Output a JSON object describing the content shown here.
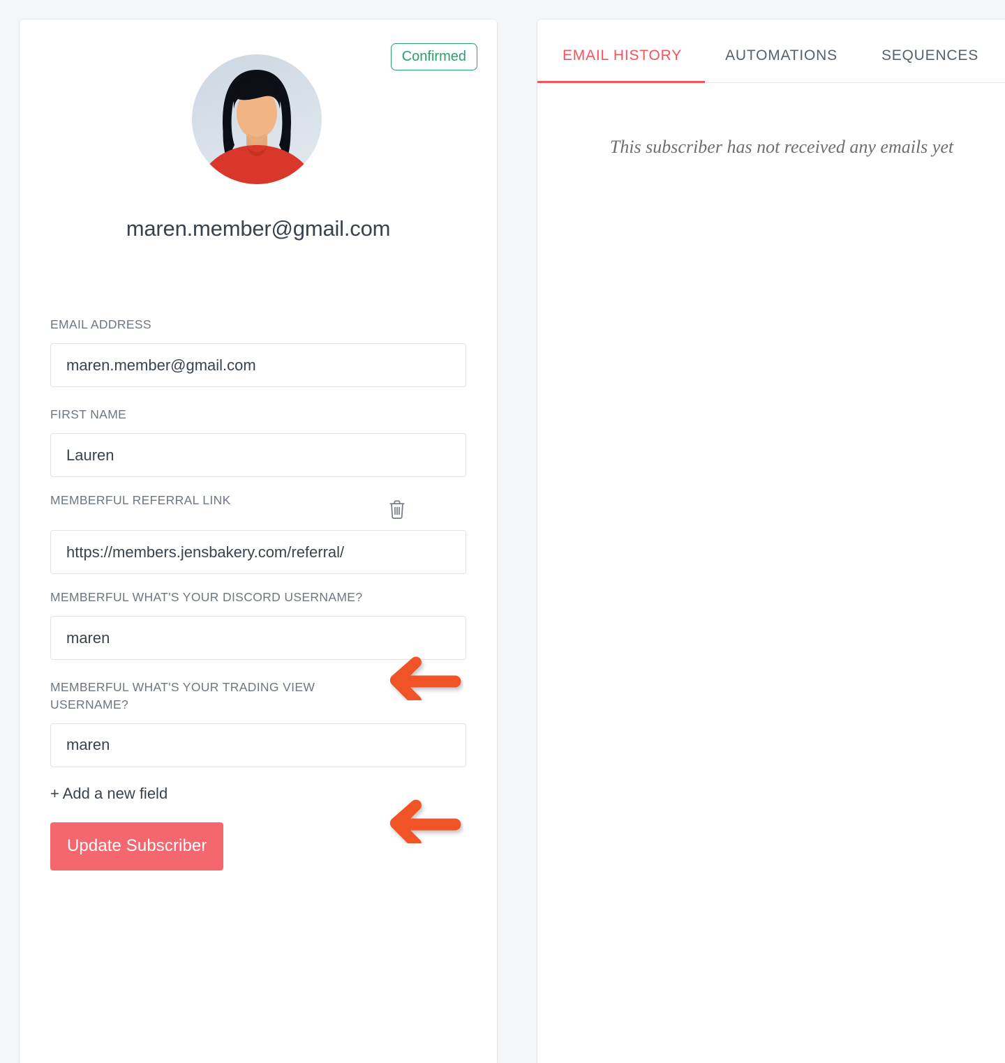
{
  "theme": {
    "page_background": "#f4f6f8",
    "card_background": "#ffffff",
    "accent_red": "#f4535c",
    "button_color": "#f4676e",
    "badge_green": "#2aa06c",
    "label_gray": "#6d7782",
    "annotation_orange": "#ef5226"
  },
  "subscriber": {
    "status_badge": "Confirmed",
    "email_heading": "maren.member@gmail.com",
    "avatar_alt": "subscriber-avatar"
  },
  "form": {
    "fields": [
      {
        "label": "EMAIL ADDRESS",
        "value": "maren.member@gmail.com",
        "placeholder": "",
        "name": "email-address",
        "deletable": false
      },
      {
        "label": "FIRST NAME",
        "value": "Lauren",
        "placeholder": "",
        "name": "first-name",
        "deletable": false
      },
      {
        "label": "MEMBERFUL REFERRAL LINK",
        "value": "https://members.jensbakery.com/referral/",
        "placeholder": "",
        "name": "memberful-referral-link",
        "deletable": true
      },
      {
        "label": "MEMBERFUL WHAT'S YOUR DISCORD USERNAME?",
        "value": "maren",
        "placeholder": "",
        "name": "memberful-discord-username",
        "deletable": false
      },
      {
        "label": "MEMBERFUL WHAT'S YOUR TRADING VIEW USERNAME?",
        "value": "maren",
        "placeholder": "",
        "name": "memberful-tradingview-username",
        "deletable": false
      }
    ],
    "add_field_label": "+ Add a new field",
    "submit_label": "Update Subscriber",
    "delete_icon": "trash-icon"
  },
  "detail_panel": {
    "tabs": [
      {
        "label": "EMAIL HISTORY",
        "active": true
      },
      {
        "label": "AUTOMATIONS",
        "active": false
      },
      {
        "label": "SEQUENCES",
        "active": false
      }
    ],
    "empty_state": "This subscriber has not received any emails yet"
  },
  "annotations": [
    {
      "type": "arrow-left",
      "target": "memberful-discord-username-label"
    },
    {
      "type": "arrow-left",
      "target": "memberful-tradingview-username-label"
    }
  ]
}
